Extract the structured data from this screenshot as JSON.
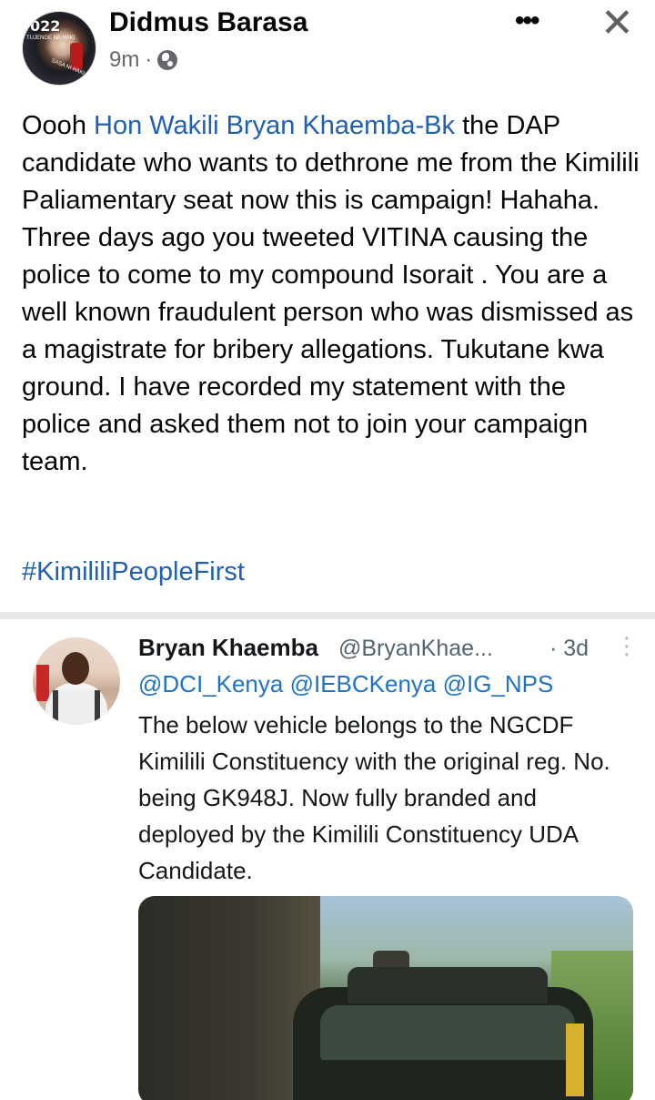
{
  "post": {
    "author": "Didmus Barasa",
    "time": "9m",
    "dot": "·",
    "more_label": "•••",
    "close_label": "✕",
    "avatar_badge": "022",
    "avatar_badge_small": "TUJENGE NA HAKI",
    "avatar_ring": "SASA NI HAKI",
    "text_before": "Oooh ",
    "mention": "Hon Wakili Bryan Khaemba-Bk",
    "text_after": "  the DAP candidate who wants to dethrone me from the Kimilili Paliamentary seat now this is campaign! Hahaha.  Three days ago you tweeted VITINA causing the police to come to my compound Isorait . You are a well known fraudulent person who was dismissed as a magistrate for bribery allegations. Tukutane kwa ground. I have recorded my statement with the police and asked them not to join your campaign team.",
    "hashtag": "#KimililiPeopleFirst"
  },
  "tweet": {
    "name": "Bryan Khaemba",
    "handle": "@BryanKhae...",
    "time": "· 3d",
    "more_label": "⋮",
    "mentions": "@DCI_Kenya @IEBCKenya @IG_NPS",
    "text": "The below vehicle belongs to the NGCDF Kimilili Constituency with the original reg. No. being GK948J. Now fully branded and deployed by the Kimilili Constituency UDA Candidate."
  },
  "icons": {
    "globe": "globe-icon",
    "more": "more-horizontal-icon",
    "close": "close-icon",
    "tweet_more": "more-vertical-icon"
  },
  "colors": {
    "link": "#1f5fb5",
    "meta": "#65676b",
    "twitter_link": "#1d73c9"
  }
}
